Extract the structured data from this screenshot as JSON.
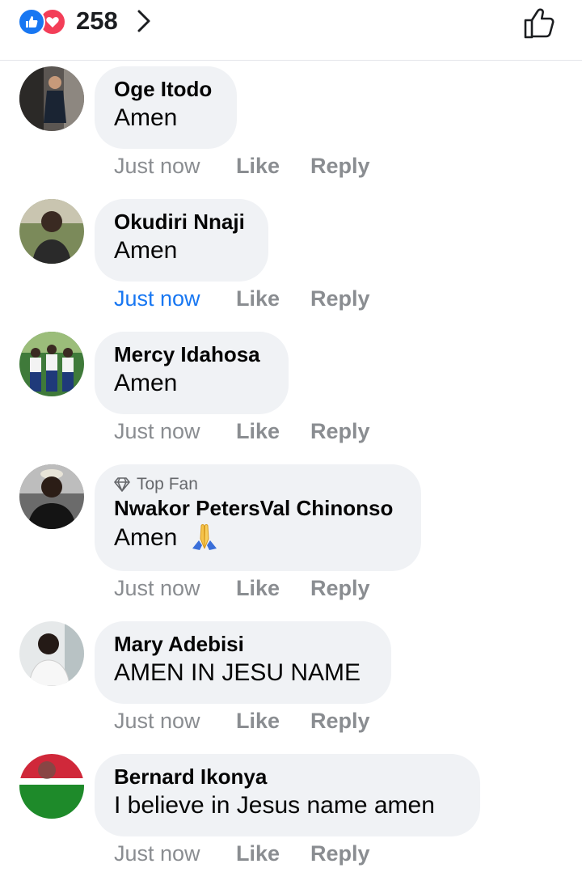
{
  "header": {
    "reaction_count": "258",
    "reaction_icons": [
      "like-icon",
      "love-icon"
    ],
    "chevron": "chevron-right-icon",
    "like_button_icon": "thumbs-up-outline-icon"
  },
  "colors": {
    "accent": "#1877f2",
    "love": "#f33e58",
    "bubble": "#f0f2f5",
    "secondary_text": "#65676b"
  },
  "comments": [
    {
      "name": "Oge Itodo",
      "text": "Amen",
      "time": "Just now",
      "like": "Like",
      "reply": "Reply",
      "time_highlighted": false
    },
    {
      "name": "Okudiri Nnaji",
      "text": "Amen",
      "time": "Just now",
      "like": "Like",
      "reply": "Reply",
      "time_highlighted": true
    },
    {
      "name": "Mercy Idahosa",
      "text": "Amen",
      "time": "Just now",
      "like": "Like",
      "reply": "Reply",
      "time_highlighted": false
    },
    {
      "badge": "Top Fan",
      "name": "Nwakor PetersVal Chinonso",
      "text": "Amen",
      "emoji": "praying-hands-emoji",
      "time": "Just now",
      "like": "Like",
      "reply": "Reply",
      "time_highlighted": false
    },
    {
      "name": "Mary Adebisi",
      "text": "AMEN IN JESU NAME",
      "time": "Just now",
      "like": "Like",
      "reply": "Reply",
      "time_highlighted": false
    },
    {
      "name": "Bernard Ikonya",
      "text": "I believe in Jesus name amen",
      "time": "Just now",
      "like": "Like",
      "reply": "Reply",
      "time_highlighted": false
    }
  ]
}
